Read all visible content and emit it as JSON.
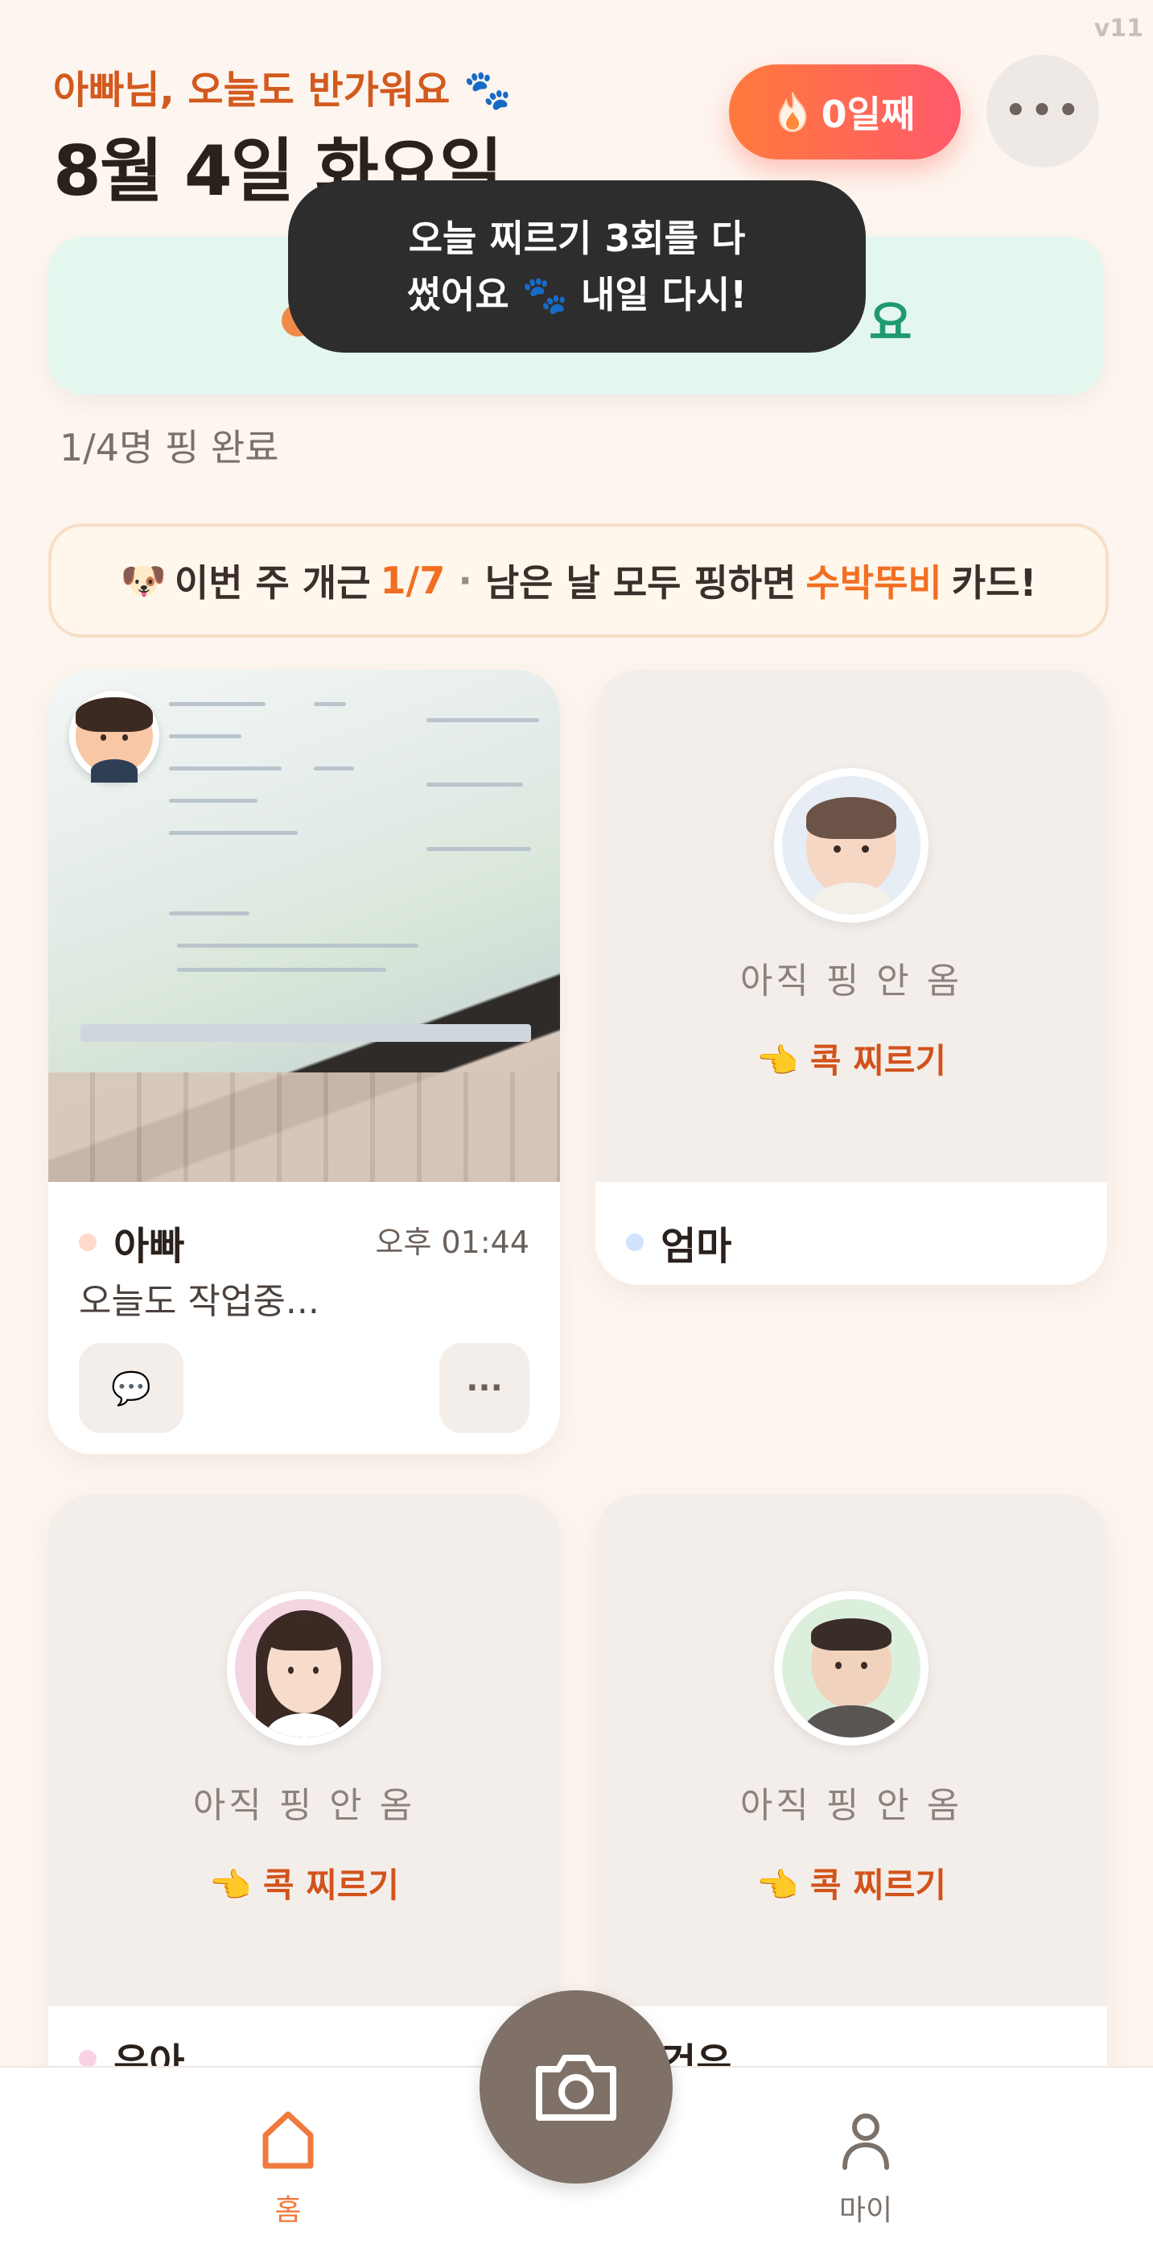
{
  "version": "v11",
  "header": {
    "greeting": "아빠님, 오늘도 반가워요 🐾",
    "date": "8월 4일 화요일",
    "streak_label": "0일째",
    "streak_icon": "fire-icon",
    "more_label": "•••"
  },
  "toast": {
    "line1": "오늘 찌르기 3회를 다",
    "line2": "썼어요 🐾 내일 다시!"
  },
  "ping_banner": {
    "peek_text": "요"
  },
  "progress_text": "1/4명 핑 완료",
  "weekly": {
    "emoji": "🐶",
    "prefix": "이번 주 개근",
    "ratio": "1/7",
    "sep": "·",
    "middle": "남은 날 모두 핑하면",
    "reward": "수박뚜비",
    "suffix": "카드!"
  },
  "members": [
    {
      "name": "아빠",
      "time": "오후 01:44",
      "status": "오늘도 작업중...",
      "dot_color": "#ffd9c9",
      "has_photo": true
    },
    {
      "name": "엄마",
      "not_yet": "아직 핑 안 옴",
      "poke": "👈 콕 찌르기",
      "dot_color": "#cfe3fb"
    },
    {
      "name": "유아",
      "not_yet": "아직 핑 안 옴",
      "poke": "👈 콕 찌르기",
      "dot_color": "#f9d3e5"
    },
    {
      "name": "건우",
      "not_yet": "아직 핑 안 옴",
      "poke": "👈 콕 찌르기",
      "dot_color": "#d8ecd9"
    }
  ],
  "card_buttons": {
    "comment_icon": "💬",
    "more_icon": "···"
  },
  "nav": {
    "home": "홈",
    "my": "마이"
  },
  "colors": {
    "accent": "#f26f22",
    "streak_start": "#ff7a3c",
    "streak_end": "#ff5a6a"
  }
}
